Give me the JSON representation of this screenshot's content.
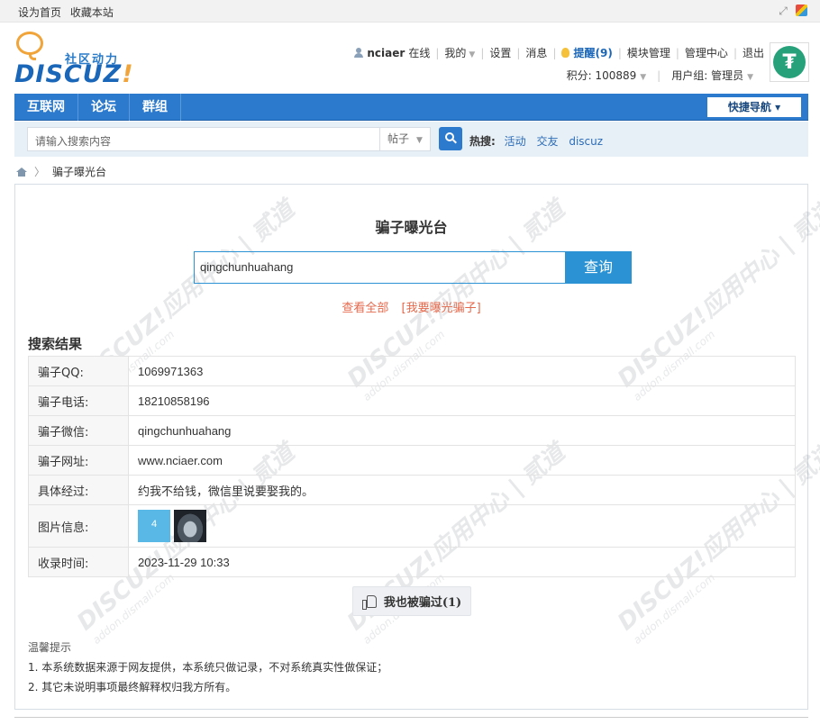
{
  "topbar": {
    "links": [
      "设为首页",
      "收藏本站"
    ]
  },
  "logo": {
    "slogan": "社区动力",
    "word_main": "DISCUZ",
    "word_mark": "!"
  },
  "user": {
    "name": "nciaer",
    "online": "在线",
    "menu": [
      "我的",
      "设置",
      "消息"
    ],
    "remind": "提醒(9)",
    "menu2": [
      "模块管理",
      "管理中心",
      "退出"
    ],
    "points": "积分: 100889",
    "group": "用户组: 管理员"
  },
  "nav": {
    "items": [
      "互联网",
      "论坛",
      "群组"
    ],
    "quick": "快捷导航"
  },
  "search": {
    "placeholder": "请输入搜索内容",
    "type": "帖子",
    "hot_label": "热搜:",
    "hot": [
      "活动",
      "交友",
      "discuz"
    ]
  },
  "breadcrumb": {
    "current": "骗子曝光台"
  },
  "page": {
    "title": "骗子曝光台",
    "query": "qingchunhuahang",
    "query_button": "查询",
    "link_all": "查看全部",
    "link_expose": "[我要曝光骗子]",
    "results_title": "搜索结果"
  },
  "results": [
    {
      "label": "骗子QQ:",
      "value": "1069971363"
    },
    {
      "label": "骗子电话:",
      "value": "18210858196"
    },
    {
      "label": "骗子微信:",
      "value": "qingchunhuahang"
    },
    {
      "label": "骗子网址:",
      "value": "www.nciaer.com"
    },
    {
      "label": "具体经过:",
      "value": "约我不给钱，微信里说要娶我的。"
    },
    {
      "label": "图片信息:",
      "value": ""
    },
    {
      "label": "收录时间:",
      "value": "2023-11-29 10:33"
    }
  ],
  "image_thumb_label": "4",
  "like_button": "我也被骗过(1)",
  "tips": {
    "heading": "温馨提示",
    "lines": [
      "1. 本系统数据来源于网友提供，本系统只做记录，不对系统真实性做保证；",
      "2. 其它未说明事项最终解释权归我方所有。"
    ]
  },
  "watermark": {
    "main": "DISCUZ!应用中心 | 贰道",
    "sub": "addon.dismall.com"
  },
  "colors": {
    "nav_blue": "#2b7acd",
    "query_blue": "#2b93d4",
    "link_orange": "#e4694c"
  }
}
